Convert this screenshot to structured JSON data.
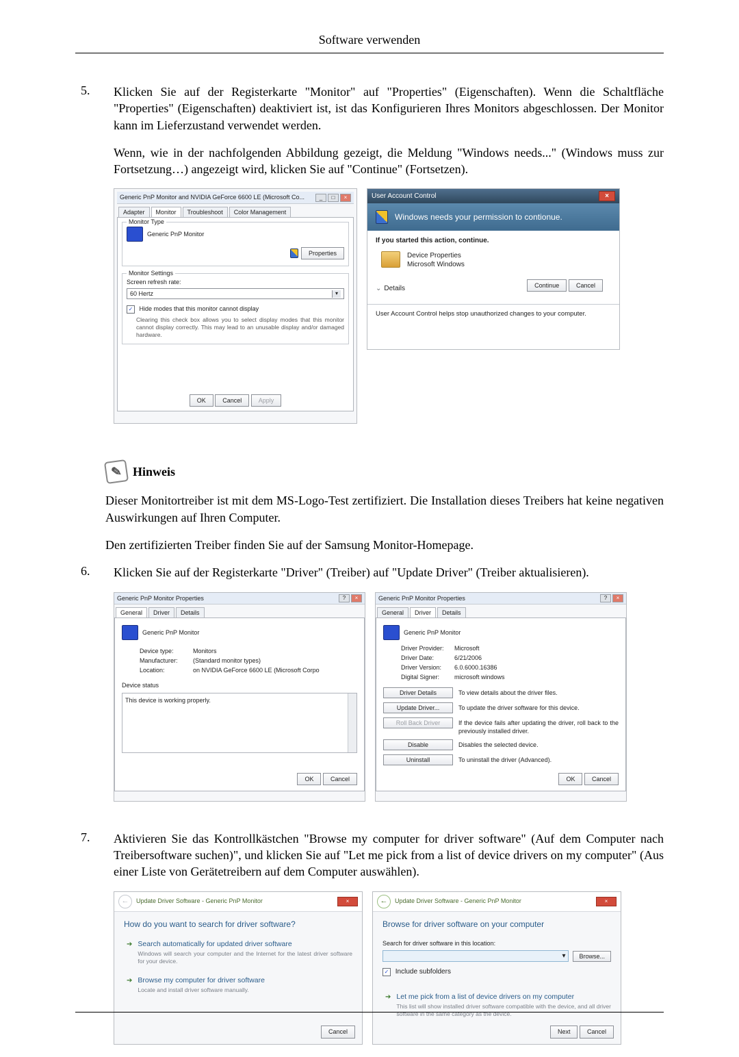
{
  "header": {
    "title": "Software verwenden"
  },
  "steps": {
    "s5": {
      "num": "5.",
      "p1": "Klicken Sie auf der Registerkarte \"Monitor\" auf \"Properties\" (Eigenschaften). Wenn die Schaltfläche \"Properties\" (Eigenschaften) deaktiviert ist, ist das Konfigurieren Ihres Monitors abgeschlossen. Der Monitor kann im Lieferzustand verwendet werden.",
      "p2": "Wenn, wie in der nachfolgenden Abbildung gezeigt, die Meldung \"Windows needs...\" (Windows muss zur Fortsetzung…) angezeigt wird, klicken Sie auf \"Continue\" (Fortsetzen)."
    },
    "s6": {
      "num": "6.",
      "p1": "Klicken Sie auf der Registerkarte \"Driver\" (Treiber) auf \"Update Driver\" (Treiber aktualisieren)."
    },
    "s7": {
      "num": "7.",
      "p1": "Aktivieren Sie das Kontrollkästchen \"Browse my computer for driver software\" (Auf dem Computer nach Treibersoftware suchen)\", und klicken Sie auf \"Let me pick from a list of device drivers on my computer\" (Aus einer Liste von Gerätetreibern auf dem Computer auswählen)."
    }
  },
  "hinweis": {
    "heading": "Hinweis",
    "p1": "Dieser Monitortreiber ist mit dem MS-Logo-Test zertifiziert. Die Installation dieses Treibers hat keine negativen Auswirkungen auf Ihren Computer.",
    "p2": "Den zertifizierten Treiber finden Sie auf der Samsung Monitor-Homepage."
  },
  "shot5a": {
    "title": "Generic PnP Monitor and NVIDIA GeForce 6600 LE (Microsoft Co...",
    "tabs": {
      "adapter": "Adapter",
      "monitor": "Monitor",
      "trouble": "Troubleshoot",
      "color": "Color Management"
    },
    "grp_type": "Monitor Type",
    "mon_name": "Generic PnP Monitor",
    "btn_props": "Properties",
    "grp_set": "Monitor Settings",
    "lbl_refresh": "Screen refresh rate:",
    "val_refresh": "60 Hertz",
    "cb_hide": "Hide modes that this monitor cannot display",
    "cb_note": "Clearing this check box allows you to select display modes that this monitor cannot display correctly. This may lead to an unusable display and/or damaged hardware.",
    "ok": "OK",
    "cancel": "Cancel",
    "apply": "Apply"
  },
  "shot5b": {
    "title": "User Account Control",
    "band": "Windows needs your permission to contionue.",
    "started": "If you started this action, continue.",
    "item1": "Device Properties",
    "item2": "Microsoft Windows",
    "details": "Details",
    "cont": "Continue",
    "cancel": "Cancel",
    "foot": "User Account Control helps stop unauthorized changes to your computer."
  },
  "shot6a": {
    "title": "Generic PnP Monitor Properties",
    "tabs": {
      "general": "General",
      "driver": "Driver",
      "details": "Details"
    },
    "mon_name": "Generic PnP Monitor",
    "devtype_k": "Device type:",
    "devtype_v": "Monitors",
    "manu_k": "Manufacturer:",
    "manu_v": "(Standard monitor types)",
    "loc_k": "Location:",
    "loc_v": "on NVIDIA GeForce 6600 LE (Microsoft Corpo",
    "devstatus": "Device status",
    "status": "This device is working properly.",
    "ok": "OK",
    "cancel": "Cancel"
  },
  "shot6b": {
    "title": "Generic PnP Monitor Properties",
    "tabs": {
      "general": "General",
      "driver": "Driver",
      "details": "Details"
    },
    "mon_name": "Generic PnP Monitor",
    "prov_k": "Driver Provider:",
    "prov_v": "Microsoft",
    "date_k": "Driver Date:",
    "date_v": "6/21/2006",
    "ver_k": "Driver Version:",
    "ver_v": "6.0.6000.16386",
    "sign_k": "Digital Signer:",
    "sign_v": "microsoft windows",
    "btn_det": "Driver Details",
    "desc_det": "To view details about the driver files.",
    "btn_upd": "Update Driver...",
    "desc_upd": "To update the driver software for this device.",
    "btn_rb": "Roll Back Driver",
    "desc_rb": "If the device fails after updating the driver, roll back to the previously installed driver.",
    "btn_dis": "Disable",
    "desc_dis": "Disables the selected device.",
    "btn_un": "Uninstall",
    "desc_un": "To uninstall the driver (Advanced).",
    "ok": "OK",
    "cancel": "Cancel"
  },
  "shot7a": {
    "crumb": "Update Driver Software - Generic PnP Monitor",
    "h": "How do you want to search for driver software?",
    "opt1_h": "Search automatically for updated driver software",
    "opt1_s": "Windows will search your computer and the Internet for the latest driver software for your device.",
    "opt2_h": "Browse my computer for driver software",
    "opt2_s": "Locate and install driver software manually.",
    "cancel": "Cancel"
  },
  "shot7b": {
    "crumb": "Update Driver Software - Generic PnP Monitor",
    "h": "Browse for driver software on your computer",
    "lbl": "Search for driver software in this location:",
    "browse": "Browse...",
    "cb": "Include subfolders",
    "opt_h": "Let me pick from a list of device drivers on my computer",
    "opt_s": "This list will show installed driver software compatible with the device, and all driver software in the same category as the device.",
    "next": "Next",
    "cancel": "Cancel"
  }
}
